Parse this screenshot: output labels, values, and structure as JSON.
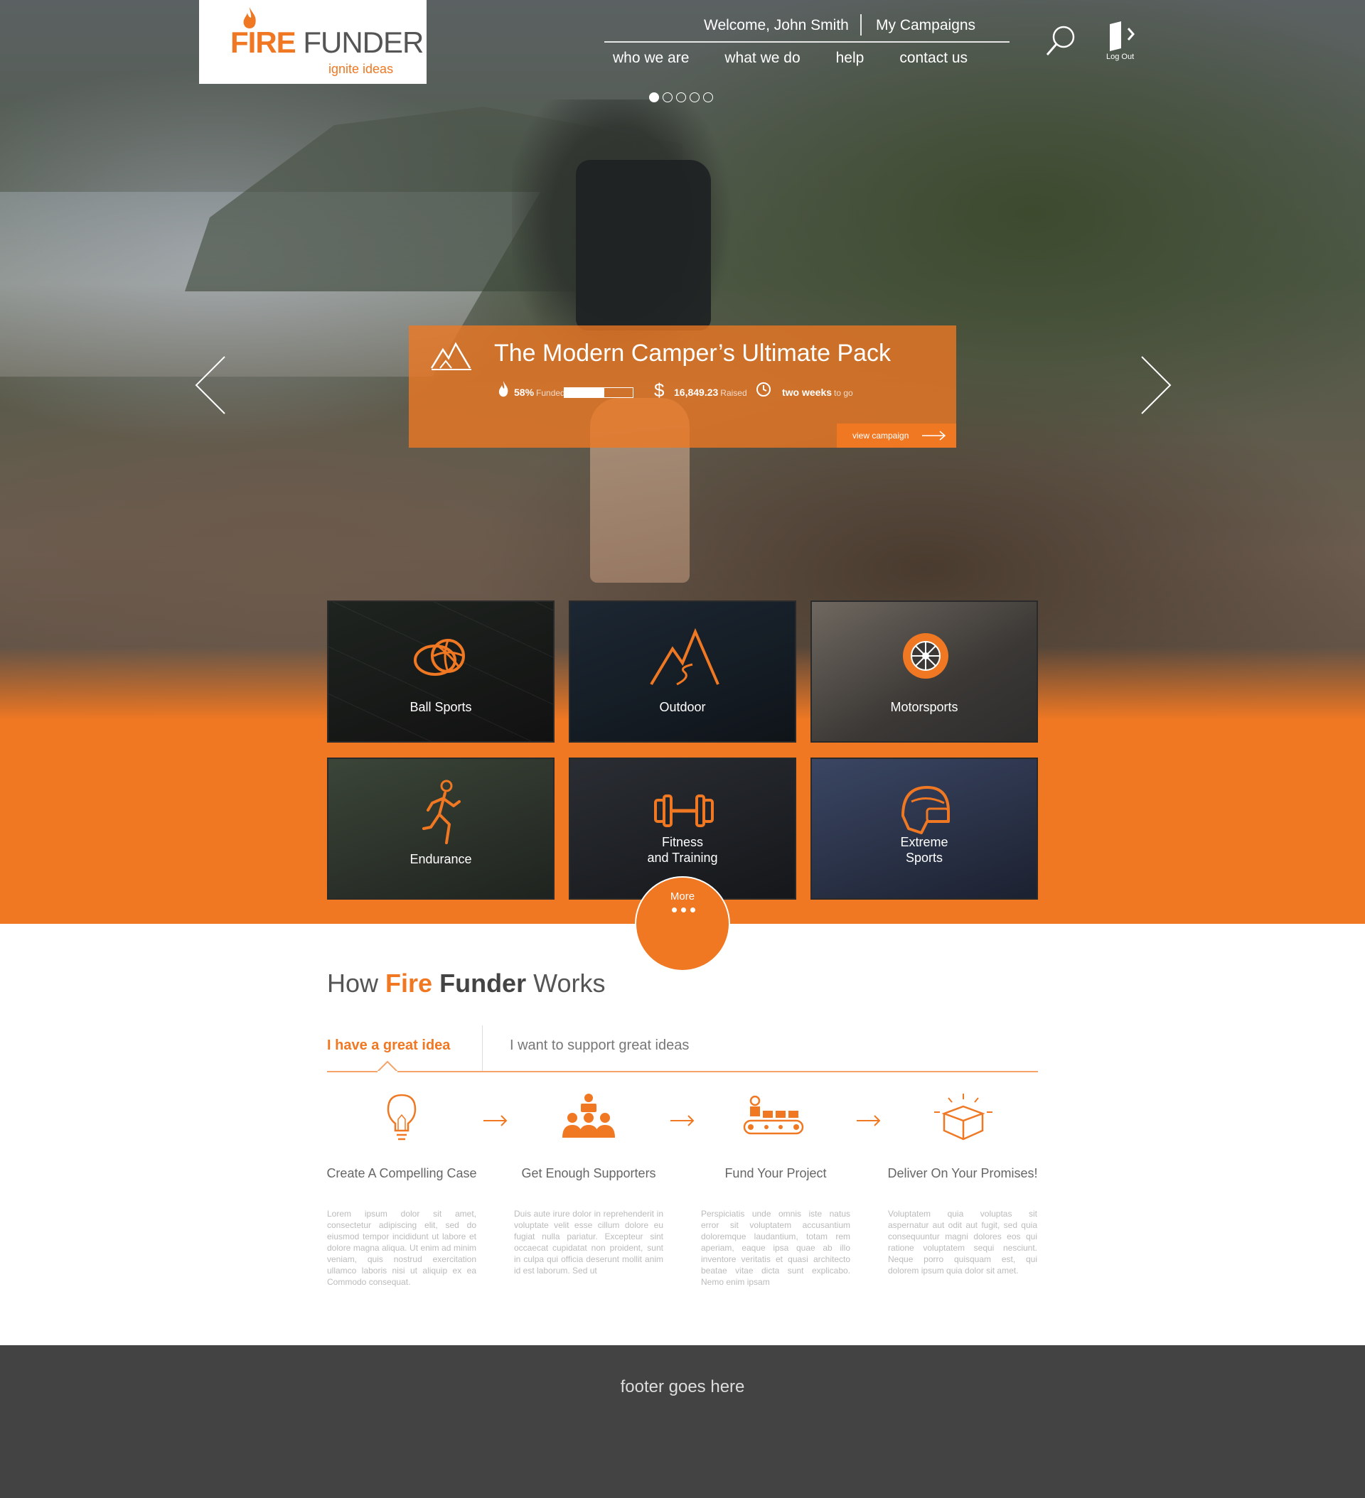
{
  "brand": {
    "name_fire": "FIRE",
    "name_funder": "FUNDER",
    "tagline": "ignite ideas",
    "accent_color": "#f07823"
  },
  "header": {
    "welcome": "Welcome, John Smith",
    "my_campaigns": "My Campaigns",
    "nav": [
      "who we are",
      "what we do",
      "help",
      "contact us"
    ],
    "logout_label": "Log Out",
    "search_icon": "search-icon",
    "logout_icon": "door-exit-icon"
  },
  "slider": {
    "dot_count": 5,
    "active_dot": 1,
    "campaign": {
      "icon": "mountain-camp-icon",
      "title": "The Modern Camper’s Ultimate Pack",
      "funded_pct": "58%",
      "funded_label": "Funded",
      "funded_fraction": 0.58,
      "raised_symbol": "$",
      "raised_amount": "16,849.23",
      "raised_label": "Raised",
      "time_left": "two weeks",
      "time_label": "to go",
      "view_button": "view campaign"
    }
  },
  "categories": [
    {
      "label": "Ball Sports",
      "icon": "ball-icon"
    },
    {
      "label": "Outdoor",
      "icon": "mountain-icon"
    },
    {
      "label": "Motorsports",
      "icon": "tire-icon"
    },
    {
      "label": "Endurance",
      "icon": "runner-icon"
    },
    {
      "label_line1": "Fitness",
      "label_line2": "and Training",
      "icon": "dumbbell-icon"
    },
    {
      "label_line1": "Extreme",
      "label_line2": "Sports",
      "icon": "helmet-icon"
    }
  ],
  "more_button": "More",
  "how": {
    "title_pre": "How",
    "title_fire": "Fire",
    "title_funder": "Funder",
    "title_post": "Works",
    "tabs": [
      "I have a great idea",
      "I want to support great ideas"
    ],
    "steps": [
      {
        "title": "Create A Compelling Case",
        "icon": "lightbulb-icon",
        "text": "Lorem ipsum dolor sit amet, consectetur adipiscing elit, sed do eiusmod tempor incididunt ut labore et dolore magna aliqua. Ut enim ad minim veniam, quis nostrud exercitation ullamco laboris nisi ut aliquip ex ea Commodo consequat."
      },
      {
        "title": "Get Enough Supporters",
        "icon": "supporters-icon",
        "text": "Duis aute irure dolor in reprehenderit in voluptate velit esse cillum dolore eu fugiat nulla pariatur. Excepteur sint occaecat cupidatat non proident, sunt in culpa qui officia deserunt mollit anim id est laborum. Sed ut"
      },
      {
        "title": "Fund Your Project",
        "icon": "conveyor-icon",
        "text": "Perspiciatis unde omnis iste natus error sit voluptatem accusantium doloremque laudantium, totam rem aperiam, eaque ipsa quae ab illo inventore veritatis et quasi architecto beatae vitae dicta sunt explicabo. Nemo enim ipsam"
      },
      {
        "title": "Deliver On Your Promises!",
        "icon": "box-icon",
        "text": "Voluptatem quia voluptas sit aspernatur aut odit aut fugit, sed quia consequuntur magni dolores eos qui ratione voluptatem sequi nesciunt. Neque porro quisquam est, qui dolorem ipsum quia dolor sit amet."
      }
    ]
  },
  "footer": {
    "text": "footer goes here"
  }
}
